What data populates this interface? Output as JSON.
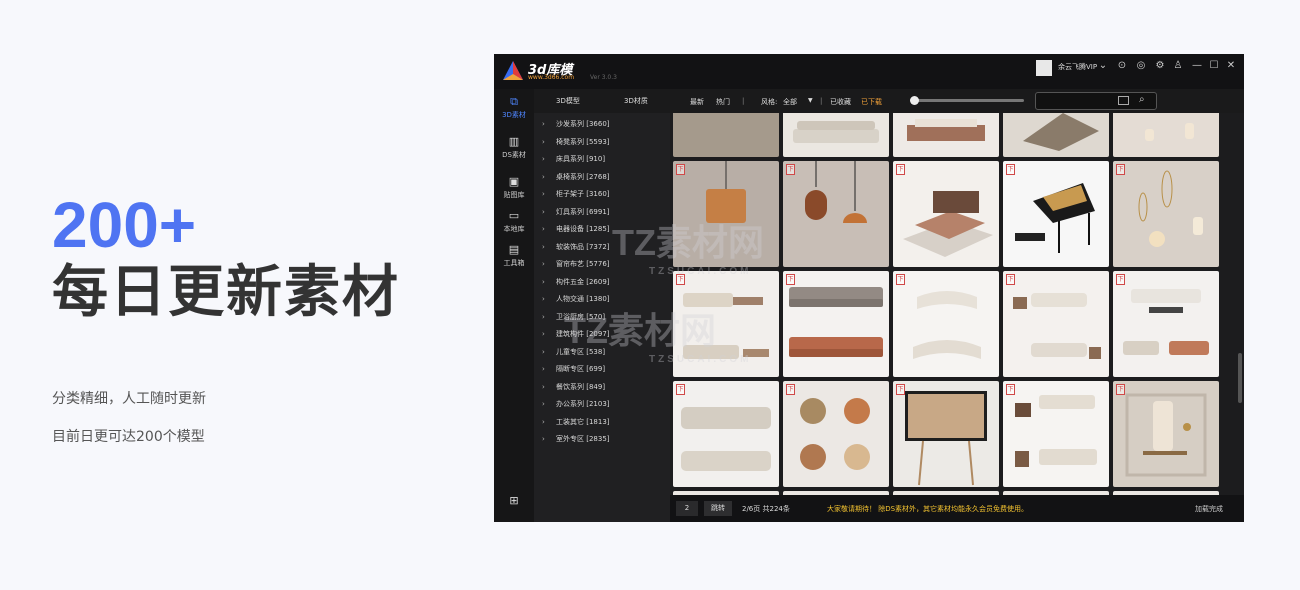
{
  "hero": {
    "number": "200+",
    "title": "每日更新素材",
    "line1": "分类精细，人工随时更新",
    "line2": "目前日更可达200个模型"
  },
  "app": {
    "logo_text": "3d库模",
    "logo_sub": "www.3d66.com",
    "version": "Ver 3.0.3",
    "user_name": "余云飞腾VIP",
    "sidebar": [
      {
        "label": "3D素材",
        "icon": "cube-icon",
        "active": true
      },
      {
        "label": "DS素材",
        "icon": "building-icon"
      },
      {
        "label": "贴图库",
        "icon": "image-stack-icon"
      },
      {
        "label": "本地库",
        "icon": "monitor-icon"
      },
      {
        "label": "工具箱",
        "icon": "clipboard-icon"
      }
    ],
    "tree_tabs": [
      "3D模型",
      "3D材质"
    ],
    "categories": [
      "沙发系列 [3660]",
      "椅凳系列 [5593]",
      "床具系列 [910]",
      "桌椅系列 [2768]",
      "柜子架子 [3160]",
      "灯具系列 [6991]",
      "电器设备 [1285]",
      "软装饰品 [7372]",
      "窗帘布艺 [5776]",
      "构件五金 [2609]",
      "人物交通 [1380]",
      "卫浴厨房 [570]",
      "建筑构件 [2097]",
      "儿童专区 [538]",
      "隔断专区 [699]",
      "餐饮系列 [849]",
      "办公系列 [2103]",
      "工装其它 [1813]",
      "室外专区 [2835]"
    ],
    "filters": {
      "latest": "最新",
      "hot": "热门",
      "style_label": "风格:",
      "style_value": "全部",
      "favorites": "已收藏",
      "downloaded": "已下载"
    },
    "footer": {
      "page_value": "2",
      "jump": "跳转",
      "page_info": "2/6页 共224条",
      "notice": "大家敬请期待！ 除DS素材外，其它素材均能永久会员免费使用。",
      "status": "加载完成"
    },
    "badge_label": "下",
    "watermark": "TZ素材网",
    "watermark_sub": "TZSUCAI.COM"
  },
  "colors": {
    "accent": "#4f74f2",
    "app_bg": "#1c1c1e",
    "notice": "#f2c230",
    "badge": "#d04848"
  }
}
